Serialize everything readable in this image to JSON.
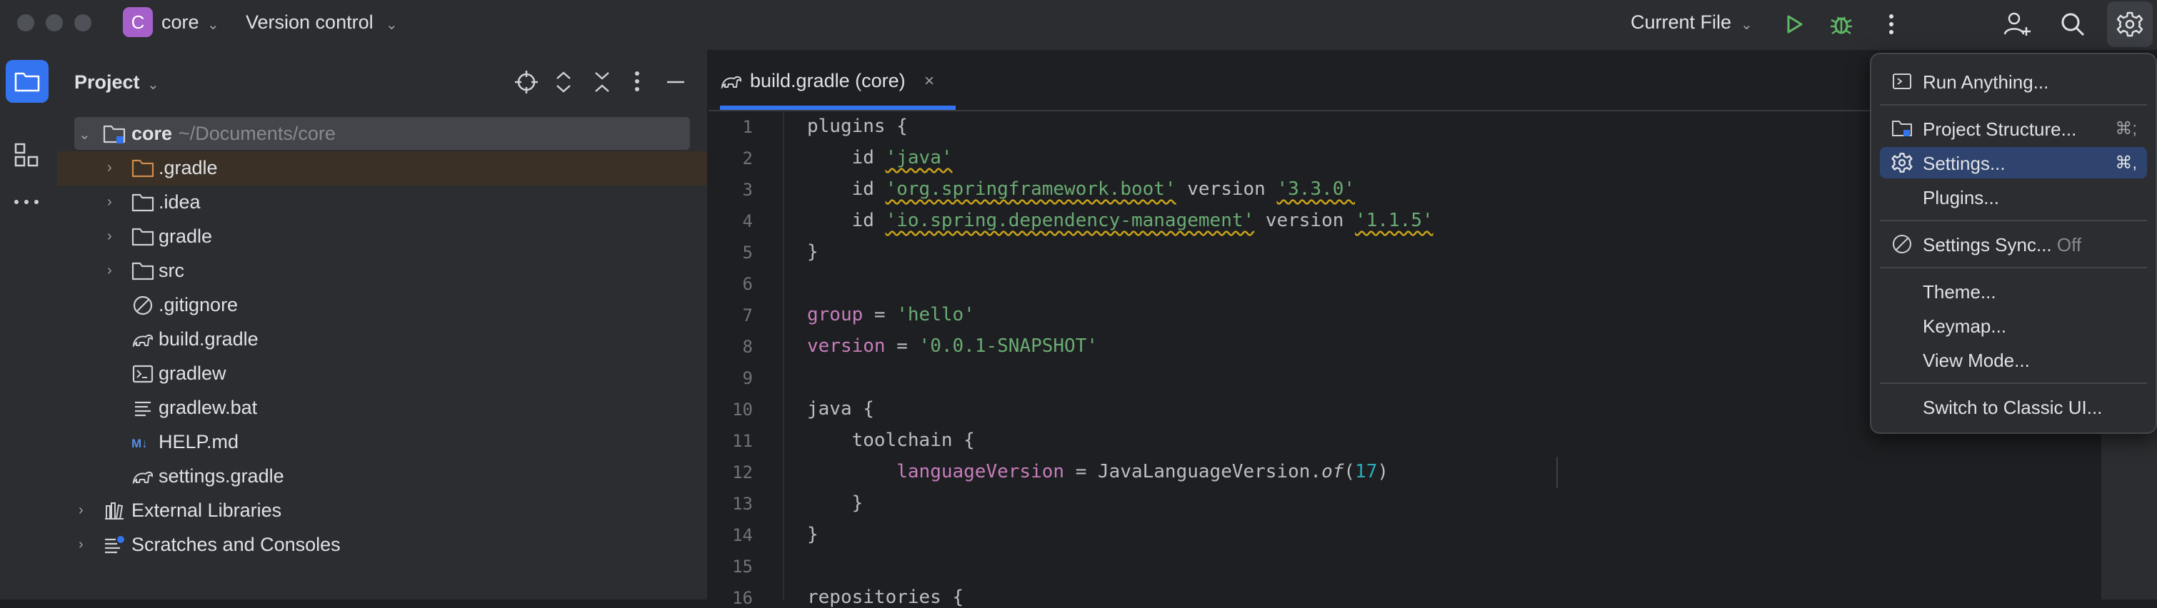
{
  "titlebar": {
    "project_badge": "C",
    "project_name": "core",
    "vcs_label": "Version control",
    "run_config": "Current File"
  },
  "project_panel": {
    "title": "Project",
    "root": {
      "name": "core",
      "path": "~/Documents/core"
    },
    "items": [
      {
        "label": ".gradle",
        "icon": "folder-icon",
        "expandable": true,
        "highlighted": true
      },
      {
        "label": ".idea",
        "icon": "folder-icon",
        "expandable": true
      },
      {
        "label": "gradle",
        "icon": "folder-icon",
        "expandable": true
      },
      {
        "label": "src",
        "icon": "folder-icon",
        "expandable": true
      },
      {
        "label": ".gitignore",
        "icon": "ignore-file-icon"
      },
      {
        "label": "build.gradle",
        "icon": "gradle-icon"
      },
      {
        "label": "gradlew",
        "icon": "terminal-file-icon"
      },
      {
        "label": "gradlew.bat",
        "icon": "text-file-icon"
      },
      {
        "label": "HELP.md",
        "icon": "markdown-icon"
      },
      {
        "label": "settings.gradle",
        "icon": "gradle-icon"
      }
    ],
    "external_libraries": "External Libraries",
    "scratches": "Scratches and Consoles"
  },
  "editor": {
    "tab_label": "build.gradle (core)",
    "line_numbers": [
      "1",
      "2",
      "3",
      "4",
      "5",
      "6",
      "7",
      "8",
      "9",
      "10",
      "11",
      "12",
      "13",
      "14",
      "15",
      "16"
    ],
    "code": {
      "l1": "plugins {",
      "l2_kw": "id",
      "l2_str": "'java'",
      "l3_kw": "id",
      "l3_str": "'org.springframework.boot'",
      "l3_kw2": "version",
      "l3_str2": "'3.3.0'",
      "l4_kw": "id",
      "l4_str": "'io.spring.dependency-management'",
      "l4_kw2": "version",
      "l4_str2": "'1.1.5'",
      "l5": "}",
      "l7_prop": "group",
      "l7_eq": " = ",
      "l7_str": "'hello'",
      "l8_prop": "version",
      "l8_eq": " = ",
      "l8_str": "'0.0.1-SNAPSHOT'",
      "l10": "java {",
      "l11": "toolchain {",
      "l12_prop": "languageVersion",
      "l12_eq": " = JavaLanguageVersion.",
      "l12_it": "of",
      "l12_num": "17",
      "l13": "}",
      "l14": "}",
      "l16": "repositories {"
    }
  },
  "menu": {
    "run_anything": "Run Anything...",
    "project_structure": "Project Structure...",
    "project_structure_shortcut": "⌘;",
    "settings": "Settings...",
    "settings_shortcut": "⌘,",
    "plugins": "Plugins...",
    "settings_sync": "Settings Sync...",
    "settings_sync_state": "Off",
    "theme": "Theme...",
    "keymap": "Keymap...",
    "view_mode": "View Mode...",
    "classic_ui": "Switch to Classic UI..."
  },
  "colors": {
    "accent": "#3574f0",
    "selection": "#2e436e",
    "string": "#6aab73",
    "keyword": "#cf8e6d",
    "property": "#c77dbb",
    "number": "#2aacb8"
  }
}
